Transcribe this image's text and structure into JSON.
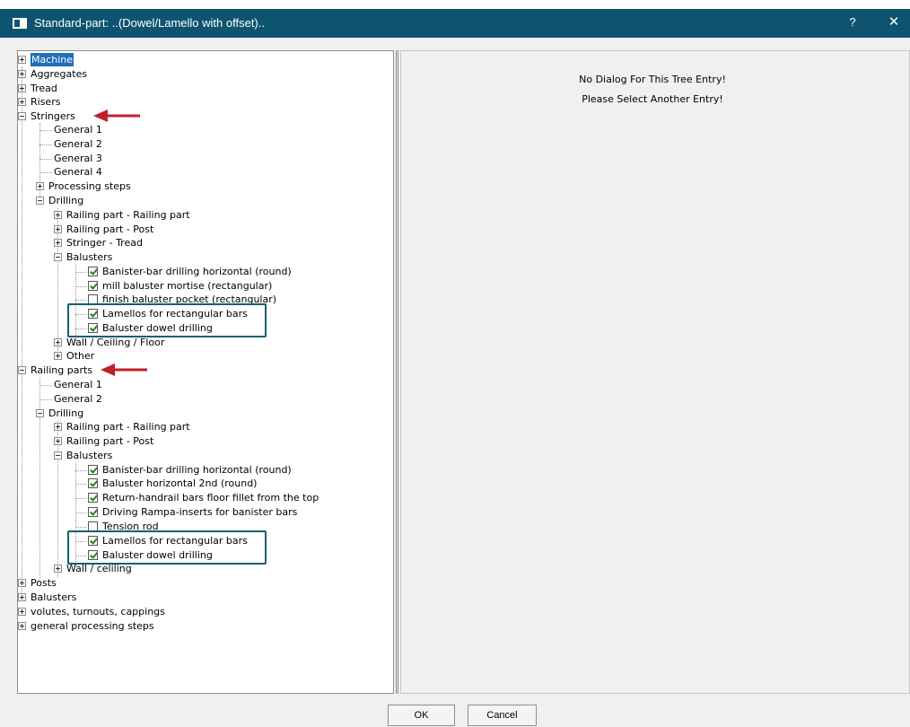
{
  "window": {
    "title": "Standard-part: ..(Dowel/Lamello with offset)..",
    "help_label": "?",
    "close_label": "✕"
  },
  "right_pane": {
    "message_line1": "No Dialog For This Tree Entry!",
    "message_line2": "Please Select Another Entry!"
  },
  "tree": {
    "machine": "Machine",
    "aggregates": "Aggregates",
    "tread": "Tread",
    "risers": "Risers",
    "stringers": {
      "label": "Stringers",
      "general1": "General  1",
      "general2": "General  2",
      "general3": "General  3",
      "general4": "General  4",
      "processing_steps": "Processing steps",
      "drilling": "Drilling",
      "railing_railing": "Railing part - Railing part",
      "railing_post": "Railing part - Post",
      "stringer_tread": "Stringer - Tread",
      "balusters": "Balusters",
      "items": [
        {
          "label": "Banister-bar drilling horizontal (round)",
          "checked": true
        },
        {
          "label": "mill baluster mortise (rectangular)",
          "checked": true
        },
        {
          "label": "finish baluster pocket (rectangular)",
          "checked": false
        },
        {
          "label": "Lamellos for rectangular bars",
          "checked": true
        },
        {
          "label": "Baluster dowel drilling",
          "checked": true
        }
      ],
      "wall_ceiling_floor": "Wall / Ceiling / Floor",
      "other": "Other"
    },
    "railing_parts": {
      "label": "Railing parts",
      "general1": "General  1",
      "general2": "General  2",
      "drilling": "Drilling",
      "railing_railing": "Railing part - Railing part",
      "railing_post": "Railing part - Post",
      "balusters": "Balusters",
      "items": [
        {
          "label": "Banister-bar drilling horizontal (round)",
          "checked": true
        },
        {
          "label": "Baluster horizontal 2nd (round)",
          "checked": true
        },
        {
          "label": "Return-handrail bars floor fillet from the top",
          "checked": true
        },
        {
          "label": "Driving Rampa-inserts for banister bars",
          "checked": true
        },
        {
          "label": "Tension rod",
          "checked": false
        },
        {
          "label": "Lamellos for rectangular bars",
          "checked": true
        },
        {
          "label": "Baluster dowel drilling",
          "checked": true
        }
      ],
      "wall_ceiling": "Wall / celiling"
    },
    "posts": "Posts",
    "balusters": "Balusters",
    "volutes": "volutes, turnouts, cappings",
    "general_processing": "general processing steps"
  },
  "buttons": {
    "ok": "OK",
    "cancel": "Cancel"
  },
  "colors": {
    "titlebar": "#0e5470",
    "highlight_box": "#135f72",
    "annotation_arrow": "#c0202a",
    "selection": "#1d6fb8"
  }
}
